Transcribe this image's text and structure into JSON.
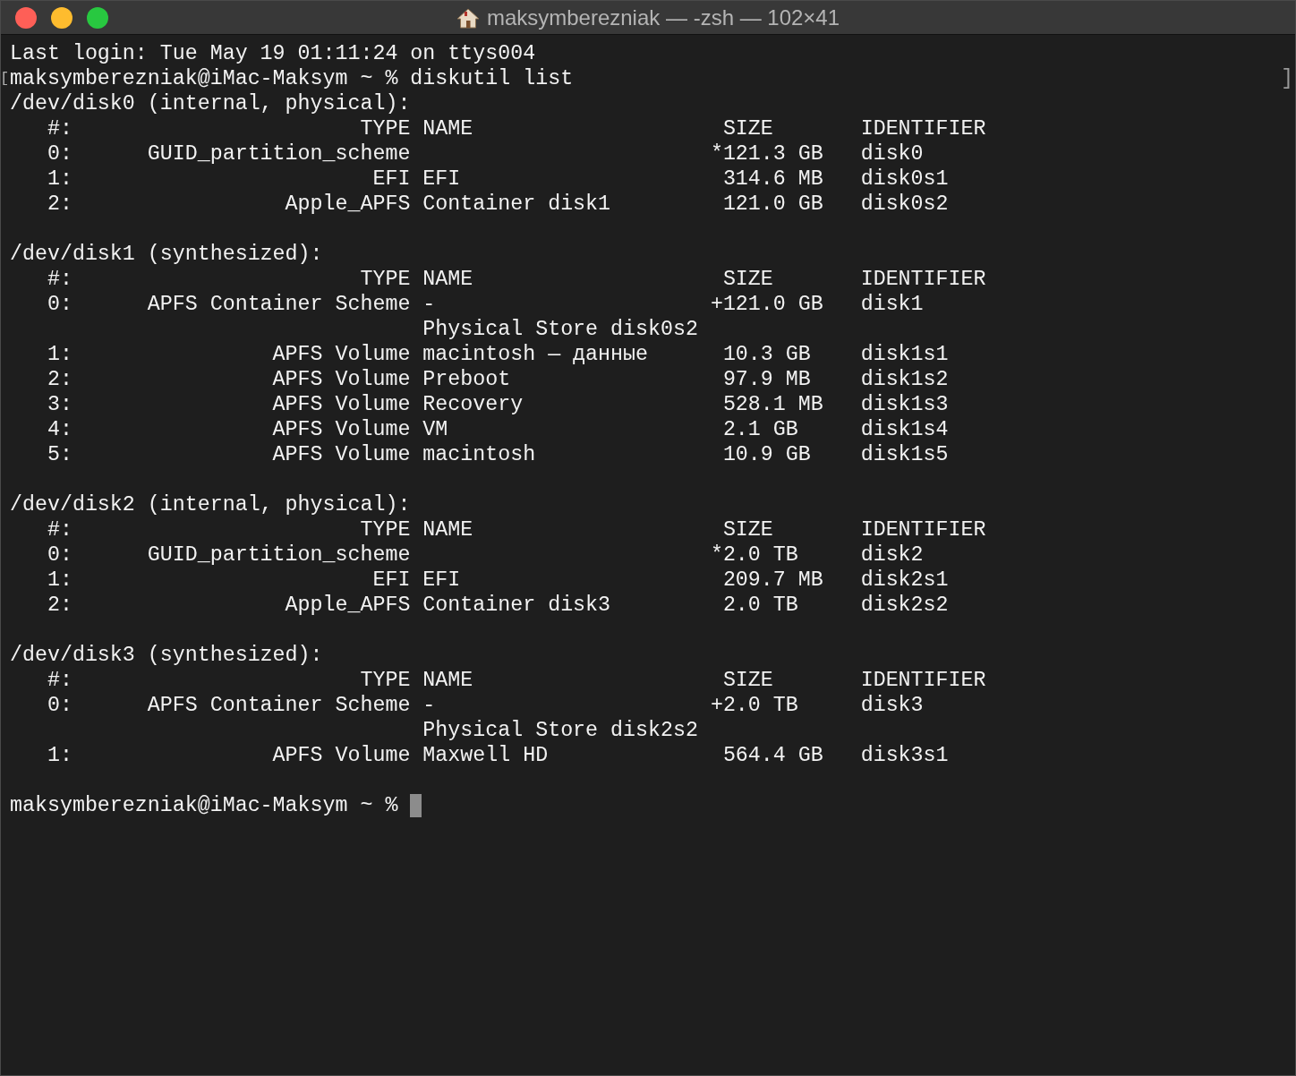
{
  "window": {
    "title": "maksymberezniak — -zsh — 102×41"
  },
  "terminal": {
    "login_line": "Last login: Tue May 19 01:11:24 on ttys004",
    "command": {
      "text": "maksymberezniak@iMac-Maksym ~ % diskutil list",
      "mark_open": "[",
      "mark_close": "]"
    },
    "disks": [
      {
        "lines": [
          "/dev/disk0 (internal, physical):",
          "   #:                       TYPE NAME                    SIZE       IDENTIFIER",
          "   0:      GUID_partition_scheme                        *121.3 GB   disk0",
          "   1:                        EFI EFI                     314.6 MB   disk0s1",
          "   2:                 Apple_APFS Container disk1         121.0 GB   disk0s2"
        ]
      },
      {
        "lines": [
          "/dev/disk1 (synthesized):",
          "   #:                       TYPE NAME                    SIZE       IDENTIFIER",
          "   0:      APFS Container Scheme -                      +121.0 GB   disk1",
          "                                 Physical Store disk0s2",
          "   1:                APFS Volume macintosh — данные      10.3 GB    disk1s1",
          "   2:                APFS Volume Preboot                 97.9 MB    disk1s2",
          "   3:                APFS Volume Recovery                528.1 MB   disk1s3",
          "   4:                APFS Volume VM                      2.1 GB     disk1s4",
          "   5:                APFS Volume macintosh               10.9 GB    disk1s5"
        ]
      },
      {
        "lines": [
          "/dev/disk2 (internal, physical):",
          "   #:                       TYPE NAME                    SIZE       IDENTIFIER",
          "   0:      GUID_partition_scheme                        *2.0 TB     disk2",
          "   1:                        EFI EFI                     209.7 MB   disk2s1",
          "   2:                 Apple_APFS Container disk3         2.0 TB     disk2s2"
        ]
      },
      {
        "lines": [
          "/dev/disk3 (synthesized):",
          "   #:                       TYPE NAME                    SIZE       IDENTIFIER",
          "   0:      APFS Container Scheme -                      +2.0 TB     disk3",
          "                                 Physical Store disk2s2",
          "   1:                APFS Volume Maxwell HD              564.4 GB   disk3s1"
        ]
      }
    ],
    "prompt": {
      "text": "maksymberezniak@iMac-Maksym ~ %",
      "cursor": true
    }
  }
}
